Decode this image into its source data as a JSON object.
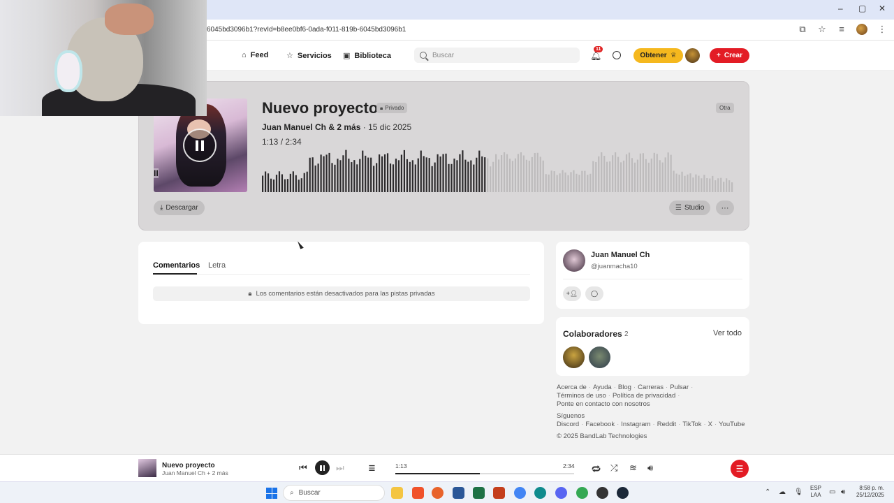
{
  "browser": {
    "url": "6045bd3096b1?revId=b8ee0bf6-0ada-f011-819b-6045bd3096b1",
    "window_controls": [
      "–",
      "▢",
      "✕"
    ]
  },
  "nav": {
    "feed": "Feed",
    "servicios": "Servicios",
    "biblioteca": "Biblioteca",
    "search_placeholder": "Buscar",
    "notifications": "11",
    "obtener": "Obtener",
    "crear": "Crear"
  },
  "track": {
    "title": "Nuevo proyecto",
    "privacy": "Privado",
    "genre": "Otra",
    "artist": "Juan Manuel Ch",
    "artist_more": "& 2 más",
    "date": "· 15 dic 2025",
    "current_time": "1:13",
    "separator": " / ",
    "duration": "2:34",
    "progress": 0.474,
    "cover_text": "II",
    "download": "Descargar",
    "studio": "Studio",
    "more": "···"
  },
  "comments": {
    "tabs": [
      "Comentarios",
      "Letra"
    ],
    "disabled_message": "Los comentarios están desactivados para las pistas privadas"
  },
  "profile": {
    "name": "Juan Manuel Ch",
    "handle": "@juanmacha10"
  },
  "collaborators": {
    "title": "Colaboradores",
    "count": "2",
    "see_all": "Ver todo"
  },
  "footer": {
    "row1": [
      "Acerca de",
      "Ayuda",
      "Blog",
      "Carreras",
      "Pulsar"
    ],
    "row2": [
      "Términos de uso",
      "Política de privacidad"
    ],
    "row3": "Ponte en contacto con nosotros",
    "follow_label": "Síguenos",
    "social": [
      "Discord",
      "Facebook",
      "Instagram",
      "Reddit",
      "TikTok",
      "X",
      "YouTube"
    ],
    "copyright": "© 2025 BandLab Technologies"
  },
  "player": {
    "title": "Nuevo proyecto",
    "artist": "Juan Manuel Ch + 2 más",
    "current": "1:13",
    "total": "2:34",
    "progress": 0.474
  },
  "taskbar": {
    "search": "Buscar",
    "lang1": "ESP",
    "lang2": "LAA",
    "time": "8:58 p. m.",
    "date": "25/12/2025"
  },
  "colors": {
    "accent_red": "#e31c25",
    "gold": "#f5b81e",
    "played_wave": "#2c2a2c",
    "unplayed_wave": "#bdbbbc"
  }
}
